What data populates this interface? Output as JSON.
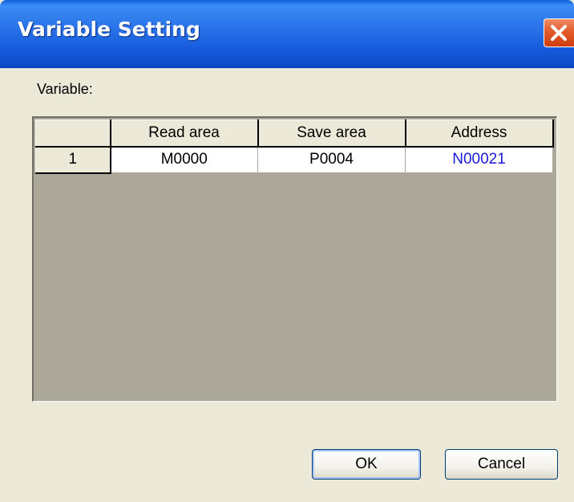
{
  "window": {
    "title": "Variable Setting",
    "close_icon": "close-x-icon",
    "colors": {
      "titlebar": "#2a74ea",
      "close_button": "#e25a2a",
      "body": "#ece9d8",
      "address_text": "#1a1adc"
    }
  },
  "variable_label": "Variable:",
  "table": {
    "headers": [
      "",
      "Read area",
      "Save area",
      "Address"
    ],
    "rows": [
      {
        "index": "1",
        "read_area": "M0000",
        "save_area": "P0004",
        "address": "N00021"
      }
    ]
  },
  "buttons": {
    "ok": "OK",
    "cancel": "Cancel"
  }
}
